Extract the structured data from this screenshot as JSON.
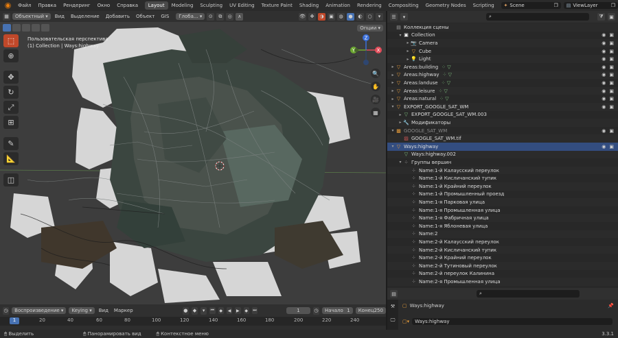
{
  "menu": [
    "Файл",
    "Правка",
    "Рендеринг",
    "Окно",
    "Справка"
  ],
  "workspace_tabs": [
    "Layout",
    "Modeling",
    "Sculpting",
    "UV Editing",
    "Texture Paint",
    "Shading",
    "Animation",
    "Rendering",
    "Compositing",
    "Geometry Nodes",
    "Scripting"
  ],
  "active_workspace": "Layout",
  "scene": "Scene",
  "view_layer": "ViewLayer",
  "viewport": {
    "mode": "Объектный",
    "menu": [
      "Вид",
      "Выделение",
      "Добавить",
      "Объект",
      "GIS"
    ],
    "orientation": "Глоба...",
    "info_line1": "Пользовательская перспектива",
    "info_line2": "(1) Collection | Ways:highway",
    "options": "Опции"
  },
  "gizmo": {
    "x": "X",
    "y": "Y",
    "z": "Z"
  },
  "timeline": {
    "playback": "Воспроизведение",
    "keying": "Keying",
    "view": "Вид",
    "marker": "Маркер",
    "current_frame": "1",
    "start_label": "Начало",
    "start": "1",
    "end_label": "Конец",
    "end": "250",
    "ticks": [
      "1",
      "20",
      "40",
      "60",
      "80",
      "100",
      "120",
      "140",
      "160",
      "180",
      "200",
      "220",
      "240"
    ]
  },
  "status": {
    "select": "Выделить",
    "pan": "Панорамировать вид",
    "context": "Контекстное меню",
    "version": "3.3.1"
  },
  "outliner": {
    "rows": [
      {
        "label": "Коллекция сцены",
        "indent": 0,
        "arrow": "",
        "icon": "scene-collection-icon",
        "color": "#a0a0a0"
      },
      {
        "label": "Collection",
        "indent": 1,
        "arrow": "▾",
        "icon": "collection-icon",
        "color": "#ffffff"
      },
      {
        "label": "Camera",
        "indent": 2,
        "arrow": "▸",
        "icon": "camera-icon",
        "color": "#e59b3a"
      },
      {
        "label": "Cube",
        "indent": 2,
        "arrow": "▸",
        "icon": "mesh-icon",
        "color": "#e59b3a"
      },
      {
        "label": "Light",
        "indent": 2,
        "arrow": "▸",
        "icon": "light-icon",
        "color": "#e59b3a"
      },
      {
        "label": "Areas:building",
        "indent": 0,
        "arrow": "▸",
        "icon": "object-icon",
        "color": "#e59b3a"
      },
      {
        "label": "Areas:highway",
        "indent": 0,
        "arrow": "▸",
        "icon": "object-icon",
        "color": "#e59b3a"
      },
      {
        "label": "Areas:landuse",
        "indent": 0,
        "arrow": "▸",
        "icon": "object-icon",
        "color": "#e59b3a"
      },
      {
        "label": "Areas:leisure",
        "indent": 0,
        "arrow": "▸",
        "icon": "object-icon",
        "color": "#e59b3a"
      },
      {
        "label": "Areas:natural",
        "indent": 0,
        "arrow": "▸",
        "icon": "object-icon",
        "color": "#e59b3a"
      },
      {
        "label": "EXPORT_GOOGLE_SAT_WM",
        "indent": 0,
        "arrow": "▾",
        "icon": "object-icon",
        "color": "#e59b3a"
      },
      {
        "label": "EXPORT_GOOGLE_SAT_WM.003",
        "indent": 1,
        "arrow": "▸",
        "icon": "mesh-data-icon",
        "color": "#7fc17f"
      },
      {
        "label": "Модификаторы",
        "indent": 1,
        "arrow": "▸",
        "icon": "wrench-icon",
        "color": "#6fa0e0"
      },
      {
        "label": "GOOGLE_SAT_WM",
        "indent": 0,
        "arrow": "▾",
        "icon": "image-object-icon",
        "color": "#e59b3a",
        "dim": true
      },
      {
        "label": "GOOGLE_SAT_WM.tif",
        "indent": 1,
        "arrow": "",
        "icon": "image-icon",
        "color": "#cc5555"
      },
      {
        "label": "Ways:highway",
        "indent": 0,
        "arrow": "▾",
        "icon": "object-icon",
        "color": "#e59b3a",
        "selected": true
      },
      {
        "label": "Ways:highway.002",
        "indent": 1,
        "arrow": "",
        "icon": "mesh-data-icon",
        "color": "#7fc17f"
      },
      {
        "label": "Группы вершин",
        "indent": 1,
        "arrow": "▾",
        "icon": "vertex-groups-icon",
        "color": "#cfcfcf"
      },
      {
        "label": "Name:1-й Калаусский переулок",
        "indent": 2,
        "arrow": "",
        "icon": "vertex-group-icon",
        "color": "#cfcfcf"
      },
      {
        "label": "Name:1-й Кисличанский тупик",
        "indent": 2,
        "arrow": "",
        "icon": "vertex-group-icon",
        "color": "#cfcfcf"
      },
      {
        "label": "Name:1-й Крайний переулок",
        "indent": 2,
        "arrow": "",
        "icon": "vertex-group-icon",
        "color": "#cfcfcf"
      },
      {
        "label": "Name:1-й Промышленный проезд",
        "indent": 2,
        "arrow": "",
        "icon": "vertex-group-icon",
        "color": "#cfcfcf"
      },
      {
        "label": "Name:1-я Парковая улица",
        "indent": 2,
        "arrow": "",
        "icon": "vertex-group-icon",
        "color": "#cfcfcf"
      },
      {
        "label": "Name:1-я Промышленная улица",
        "indent": 2,
        "arrow": "",
        "icon": "vertex-group-icon",
        "color": "#cfcfcf"
      },
      {
        "label": "Name:1-я Фабричная улица",
        "indent": 2,
        "arrow": "",
        "icon": "vertex-group-icon",
        "color": "#cfcfcf"
      },
      {
        "label": "Name:1-я Яблоневая улица",
        "indent": 2,
        "arrow": "",
        "icon": "vertex-group-icon",
        "color": "#cfcfcf"
      },
      {
        "label": "Name:2",
        "indent": 2,
        "arrow": "",
        "icon": "vertex-group-icon",
        "color": "#cfcfcf"
      },
      {
        "label": "Name:2-й Калаусский переулок",
        "indent": 2,
        "arrow": "",
        "icon": "vertex-group-icon",
        "color": "#cfcfcf"
      },
      {
        "label": "Name:2-й Кисличанский тупик",
        "indent": 2,
        "arrow": "",
        "icon": "vertex-group-icon",
        "color": "#cfcfcf"
      },
      {
        "label": "Name:2-й Крайний переулок",
        "indent": 2,
        "arrow": "",
        "icon": "vertex-group-icon",
        "color": "#cfcfcf"
      },
      {
        "label": "Name:2-й Тутиновый переулок",
        "indent": 2,
        "arrow": "",
        "icon": "vertex-group-icon",
        "color": "#cfcfcf"
      },
      {
        "label": "Name:2-й переулок Калинина",
        "indent": 2,
        "arrow": "",
        "icon": "vertex-group-icon",
        "color": "#cfcfcf"
      },
      {
        "label": "Name:2-я Промышленная улица",
        "indent": 2,
        "arrow": "",
        "icon": "vertex-group-icon",
        "color": "#cfcfcf"
      }
    ]
  },
  "properties": {
    "object_name": "Ways:highway",
    "name_field": "Ways:highway"
  },
  "colors": {
    "accent": "#4772b3",
    "object_orange": "#e59b3a",
    "selection": "#334d80"
  }
}
